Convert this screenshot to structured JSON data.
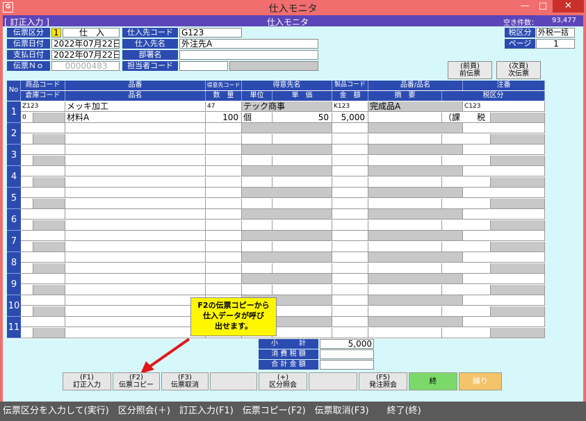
{
  "window": {
    "title": "仕入モニタ",
    "min": "—",
    "max": "□",
    "close": "✕",
    "icon": "app-icon"
  },
  "topbar": {
    "mode": "[ 訂正入力 ]",
    "screen": "仕入モニタ",
    "count_label": "空き件数：",
    "count_value": "93,477"
  },
  "header": {
    "denpyo_kubun": {
      "label": "伝票区分",
      "code": "1",
      "value": "仕　入"
    },
    "denpyo_date": {
      "label": "伝票日付",
      "value": "2022年07月22日"
    },
    "pay_date": {
      "label": "支払日付",
      "value": "2022年07月22日"
    },
    "denpyo_no": {
      "label": "伝票Ｎｏ",
      "value": "00000483"
    },
    "supplier_code": {
      "label": "仕入先コード",
      "value": "G123"
    },
    "supplier_name": {
      "label": "仕入先名",
      "value": "外注先A"
    },
    "department": {
      "label": "部署名",
      "value": ""
    },
    "staff_code": {
      "label": "担当者コード",
      "value": ""
    },
    "tax_kubun": {
      "label": "税区分",
      "value": "外税一括"
    },
    "page": {
      "label": "ページ",
      "value": "1"
    }
  },
  "nav": {
    "prev": [
      "(前頁)",
      "前伝票"
    ],
    "next": [
      "(次頁)",
      "次伝票"
    ]
  },
  "grid_headers": {
    "no": "No",
    "row1": [
      "商品コード",
      "品番",
      "得意先コード",
      "得意先名",
      "製品コード",
      "品番/品名",
      "注番"
    ],
    "row2": [
      "倉庫コード",
      "品名",
      "数　量",
      "単位",
      "単　価",
      "金　額",
      "摘　要",
      "税区分"
    ]
  },
  "rows": [
    {
      "no": "1",
      "product_code": "Z123",
      "hinban": "メッキ加工",
      "customer_code": "47",
      "customer_name": "テック商事",
      "seihin_code": "K123",
      "hinban_name": "完成品A",
      "chuban": "C123",
      "warehouse_code": "0",
      "hinmei": "材料A",
      "qty": "100",
      "unit": "個",
      "unit_price": "50",
      "amount": "5,000",
      "tekiyo": "",
      "tax": "（課　　税"
    },
    {
      "no": "2"
    },
    {
      "no": "3"
    },
    {
      "no": "4"
    },
    {
      "no": "5"
    },
    {
      "no": "6"
    },
    {
      "no": "7"
    },
    {
      "no": "8"
    },
    {
      "no": "9"
    },
    {
      "no": "10"
    },
    {
      "no": "11"
    }
  ],
  "totals": {
    "subtotal": {
      "label": "小　　　計",
      "value": "5,000"
    },
    "tax": {
      "label": "消 費 税 額",
      "value": ""
    },
    "total": {
      "label": "合 計 金 額",
      "value": ""
    }
  },
  "callout": {
    "lines": [
      "F2の伝票コピーから",
      "仕入データが呼び",
      "出せます。"
    ]
  },
  "fkeys": [
    {
      "key": "(F1)",
      "label": "訂正入力"
    },
    {
      "key": "(F2)",
      "label": "伝票コピー"
    },
    {
      "key": "(F3)",
      "label": "伝票取消"
    },
    {
      "key": "",
      "label": ""
    },
    {
      "key": "(+)",
      "label": "区分照会"
    },
    {
      "key": "",
      "label": ""
    },
    {
      "key": "(F5)",
      "label": "発注照会"
    },
    {
      "key": "",
      "label": "終"
    },
    {
      "key": "",
      "label": "繰り"
    }
  ],
  "status": {
    "text": "伝票区分を入力して(実行)　区分照会(＋)　訂正入力(F1)　伝票コピー(F2)　伝票取消(F3)　　終了(終)"
  },
  "colors": {
    "header_blue": "#2b4bb0",
    "topbar": "#5c45b8",
    "bg": "#d6f8fa",
    "titlebar": "#f06e6e",
    "callout": "#fff700"
  }
}
